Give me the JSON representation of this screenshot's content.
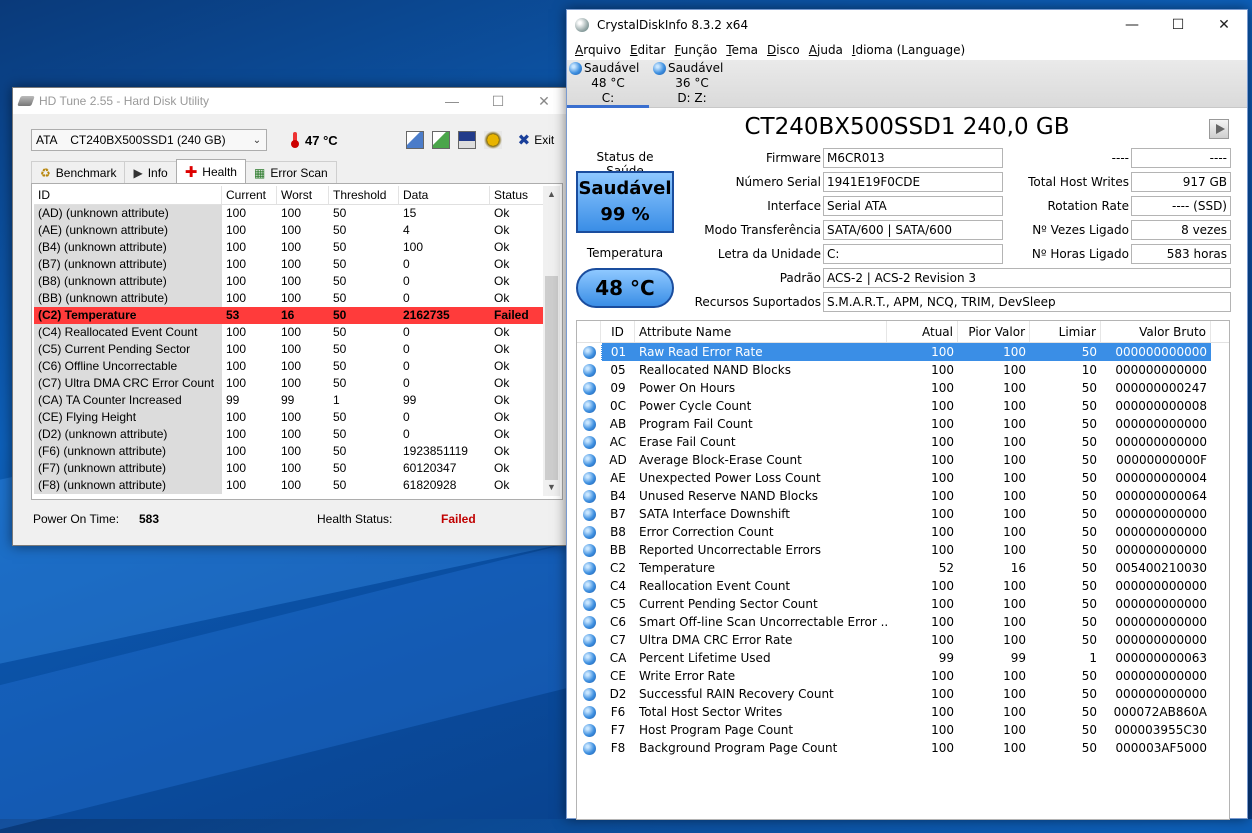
{
  "hdtune": {
    "title": "HD Tune 2.55 - Hard Disk Utility",
    "drive": "ATA    CT240BX500SSD1 (240 GB)",
    "temperature": "47 °C",
    "exit_label": "Exit",
    "tabs": [
      {
        "label": "Benchmark",
        "icon": "benchmark-icon"
      },
      {
        "label": "Info",
        "icon": "info-icon"
      },
      {
        "label": "Health",
        "icon": "health-cross-icon"
      },
      {
        "label": "Error Scan",
        "icon": "error-scan-icon"
      }
    ],
    "columns": [
      "ID",
      "Current",
      "Worst",
      "Threshold",
      "Data",
      "Status"
    ],
    "rows": [
      [
        "(AD) (unknown attribute)",
        "100",
        "100",
        "50",
        "15",
        "Ok"
      ],
      [
        "(AE) (unknown attribute)",
        "100",
        "100",
        "50",
        "4",
        "Ok"
      ],
      [
        "(B4) (unknown attribute)",
        "100",
        "100",
        "50",
        "100",
        "Ok"
      ],
      [
        "(B7) (unknown attribute)",
        "100",
        "100",
        "50",
        "0",
        "Ok"
      ],
      [
        "(B8) (unknown attribute)",
        "100",
        "100",
        "50",
        "0",
        "Ok"
      ],
      [
        "(BB) (unknown attribute)",
        "100",
        "100",
        "50",
        "0",
        "Ok"
      ],
      [
        "(C2) Temperature",
        "53",
        "16",
        "50",
        "2162735",
        "Failed"
      ],
      [
        "(C4) Reallocated Event Count",
        "100",
        "100",
        "50",
        "0",
        "Ok"
      ],
      [
        "(C5) Current Pending Sector",
        "100",
        "100",
        "50",
        "0",
        "Ok"
      ],
      [
        "(C6) Offline Uncorrectable",
        "100",
        "100",
        "50",
        "0",
        "Ok"
      ],
      [
        "(C7) Ultra DMA CRC Error Count",
        "100",
        "100",
        "50",
        "0",
        "Ok"
      ],
      [
        "(CA) TA Counter Increased",
        "99",
        "99",
        "1",
        "99",
        "Ok"
      ],
      [
        "(CE) Flying Height",
        "100",
        "100",
        "50",
        "0",
        "Ok"
      ],
      [
        "(D2) (unknown attribute)",
        "100",
        "100",
        "50",
        "0",
        "Ok"
      ],
      [
        "(F6) (unknown attribute)",
        "100",
        "100",
        "50",
        "1923851119",
        "Ok"
      ],
      [
        "(F7) (unknown attribute)",
        "100",
        "100",
        "50",
        "60120347",
        "Ok"
      ],
      [
        "(F8) (unknown attribute)",
        "100",
        "100",
        "50",
        "61820928",
        "Ok"
      ]
    ],
    "footer": {
      "power_on_label": "Power On Time:",
      "power_on_value": "583",
      "health_label": "Health Status:",
      "health_value": "Failed"
    }
  },
  "cdi": {
    "title": "CrystalDiskInfo 8.3.2 x64",
    "menu": [
      "Arquivo",
      "Editar",
      "Função",
      "Tema",
      "Disco",
      "Ajuda",
      "Idioma (Language)"
    ],
    "drives": [
      {
        "status": "Saudável",
        "temp": "48 °C",
        "letter": "C:"
      },
      {
        "status": "Saudável",
        "temp": "36 °C",
        "letter": "D: Z:"
      }
    ],
    "model": "CT240BX500SSD1 240,0 GB",
    "health_label": "Status de Saúde",
    "health_status": "Saudável",
    "health_percent": "99 %",
    "temp_label": "Temperatura",
    "temp_value": "48 °C",
    "info": {
      "firmware_label": "Firmware",
      "firmware": "M6CR013",
      "serial_label": "Número Serial",
      "serial": "1941E19F0CDE",
      "interface_label": "Interface",
      "interface": "Serial ATA",
      "transfer_label": "Modo Transferência",
      "transfer": "SATA/600 | SATA/600",
      "letter_label": "Letra da Unidade",
      "letter": "C:",
      "standard_label": "Padrão",
      "standard": "ACS-2 | ACS-2 Revision 3",
      "features_label": "Recursos Suportados",
      "features": "S.M.A.R.T., APM, NCQ, TRIM, DevSleep",
      "r1_label": "----",
      "r1": "----",
      "host_writes_label": "Total Host Writes",
      "host_writes": "917 GB",
      "rotation_label": "Rotation Rate",
      "rotation": "---- (SSD)",
      "power_count_label": "Nº Vezes Ligado",
      "power_count": "8 vezes",
      "power_hours_label": "Nº Horas Ligado",
      "power_hours": "583 horas"
    },
    "columns": [
      "ID",
      "Attribute Name",
      "Atual",
      "Pior Valor",
      "Limiar",
      "Valor Bruto"
    ],
    "rows": [
      [
        "01",
        "Raw Read Error Rate",
        "100",
        "100",
        "50",
        "000000000000"
      ],
      [
        "05",
        "Reallocated NAND Blocks",
        "100",
        "100",
        "10",
        "000000000000"
      ],
      [
        "09",
        "Power On Hours",
        "100",
        "100",
        "50",
        "000000000247"
      ],
      [
        "0C",
        "Power Cycle Count",
        "100",
        "100",
        "50",
        "000000000008"
      ],
      [
        "AB",
        "Program Fail Count",
        "100",
        "100",
        "50",
        "000000000000"
      ],
      [
        "AC",
        "Erase Fail Count",
        "100",
        "100",
        "50",
        "000000000000"
      ],
      [
        "AD",
        "Average Block-Erase Count",
        "100",
        "100",
        "50",
        "00000000000F"
      ],
      [
        "AE",
        "Unexpected Power Loss Count",
        "100",
        "100",
        "50",
        "000000000004"
      ],
      [
        "B4",
        "Unused Reserve NAND Blocks",
        "100",
        "100",
        "50",
        "000000000064"
      ],
      [
        "B7",
        "SATA Interface Downshift",
        "100",
        "100",
        "50",
        "000000000000"
      ],
      [
        "B8",
        "Error Correction Count",
        "100",
        "100",
        "50",
        "000000000000"
      ],
      [
        "BB",
        "Reported Uncorrectable Errors",
        "100",
        "100",
        "50",
        "000000000000"
      ],
      [
        "C2",
        "Temperature",
        "52",
        "16",
        "50",
        "005400210030"
      ],
      [
        "C4",
        "Reallocation Event Count",
        "100",
        "100",
        "50",
        "000000000000"
      ],
      [
        "C5",
        "Current Pending Sector Count",
        "100",
        "100",
        "50",
        "000000000000"
      ],
      [
        "C6",
        "Smart Off-line Scan Uncorrectable Error ...",
        "100",
        "100",
        "50",
        "000000000000"
      ],
      [
        "C7",
        "Ultra DMA CRC Error Rate",
        "100",
        "100",
        "50",
        "000000000000"
      ],
      [
        "CA",
        "Percent Lifetime Used",
        "99",
        "99",
        "1",
        "000000000063"
      ],
      [
        "CE",
        "Write Error Rate",
        "100",
        "100",
        "50",
        "000000000000"
      ],
      [
        "D2",
        "Successful RAIN Recovery Count",
        "100",
        "100",
        "50",
        "000000000000"
      ],
      [
        "F6",
        "Total Host Sector Writes",
        "100",
        "100",
        "50",
        "000072AB860A"
      ],
      [
        "F7",
        "Host Program Page Count",
        "100",
        "100",
        "50",
        "000003955C30"
      ],
      [
        "F8",
        "Background Program Page Count",
        "100",
        "100",
        "50",
        "000003AF5000"
      ]
    ]
  },
  "colors": {
    "failed_row": "#ff3b3b",
    "failed_text": "#c00000",
    "health_blue": "#3a8ee6"
  }
}
